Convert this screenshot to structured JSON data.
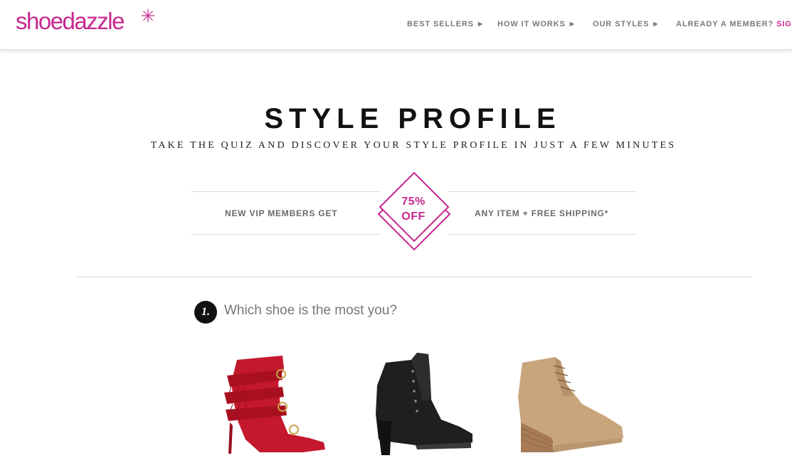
{
  "header": {
    "logo_text": "shoedazzle",
    "nav": [
      {
        "label": "BEST SELLERS"
      },
      {
        "label": "HOW IT WORKS"
      },
      {
        "label": "OUR STYLES"
      }
    ],
    "member_label": "ALREADY A MEMBER?",
    "sign_label": "SIGN"
  },
  "hero": {
    "title": "STYLE PROFILE",
    "subtitle": "TAKE THE QUIZ AND DISCOVER YOUR STYLE PROFILE IN JUST A FEW MINUTES"
  },
  "promo": {
    "left_text": "NEW VIP MEMBERS GET",
    "badge_line1": "75%",
    "badge_line2": "OFF",
    "right_text": "ANY ITEM + FREE SHIPPING*"
  },
  "quiz": {
    "question_number": "1.",
    "question_text": "Which shoe is the most you?",
    "options": [
      {
        "name": "red fringe buckle bootie",
        "color": "#c4182d"
      },
      {
        "name": "black suede studded bootie",
        "color": "#1a1a1a"
      },
      {
        "name": "tan lace-up wedge bootie",
        "color": "#c9a57d"
      }
    ]
  },
  "colors": {
    "brand": "#c8278f",
    "nav_text": "#7a7a7a"
  }
}
